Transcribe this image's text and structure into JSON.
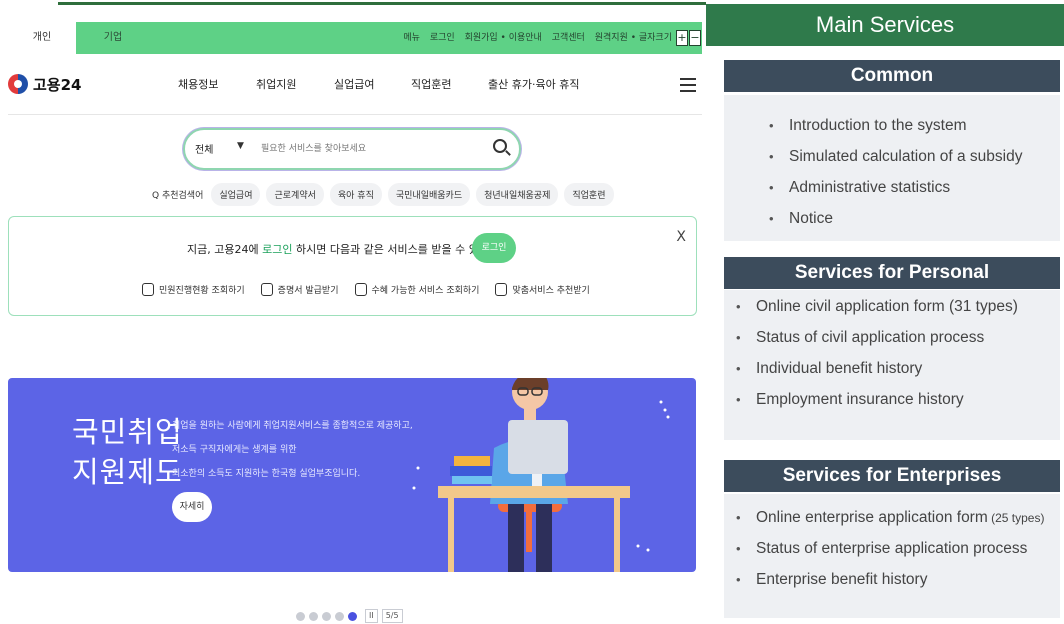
{
  "site": {
    "tabs": [
      {
        "label": "개인"
      },
      {
        "label": "기업"
      }
    ],
    "util_links": [
      "메뉴",
      "로그인",
      "회원가입 • 이용안내",
      "고객센터",
      "원격지원 • 글자크기"
    ],
    "font_plus": "+",
    "font_minus": "−",
    "logo_text": "고용24",
    "nav": [
      "채용정보",
      "취업지원",
      "실업급여",
      "직업훈련",
      "출산 휴가·육아 휴직"
    ],
    "search": {
      "scope": "전체",
      "placeholder": "필요한 서비스를 찾아보세요"
    },
    "recommend_label": "추천검색어",
    "chips": [
      "실업급여",
      "근로계약서",
      "육아 휴직",
      "국민내일배움카드",
      "청년내일채움공제",
      "직업훈련"
    ],
    "notice": {
      "message_before": "지금, 고용24에 ",
      "message_link": "로그인",
      "message_after": " 하시면 다음과 같은 서비스를 받을 수 있습니다.",
      "login_button": "로그인",
      "close": "X",
      "quick_links": [
        "민원진행현황 조회하기",
        "증명서 발급받기",
        "수혜 가능한 서비스 조회하기",
        "맞춤서비스 추천받기"
      ]
    },
    "banner": {
      "title": "국민취업\n지원제도",
      "description": "취업을 원하는 사람에게 취업지원서비스를 종합적으로 제공하고,\n저소득 구직자에게는 생계를 위한\n최소한의 소득도 지원하는 한국형 실업부조입니다.",
      "button": "자세히",
      "color": "#5c64e6"
    },
    "pager": {
      "pause": "II",
      "page": "5/5"
    }
  },
  "panel": {
    "header": "Main Services",
    "sections": [
      {
        "title": "Common",
        "items": [
          "Introduction to the system",
          "Simulated calculation of a subsidy",
          "Administrative statistics",
          "Notice"
        ]
      },
      {
        "title": "Services for Personal",
        "items": [
          "Online civil application form (31 types)",
          "Status of civil application process",
          "Individual benefit history",
          "Employment insurance history"
        ]
      },
      {
        "title": "Services for Enterprises",
        "items_main": "Online enterprise application form",
        "items_main_suffix": " (25 types)",
        "items": [
          "Status of enterprise application process",
          "Enterprise benefit history"
        ]
      }
    ],
    "colors": {
      "header_bg": "#2f7a4b",
      "section_title_bg": "#3c4c5c",
      "section_body_bg": "#eef0f3"
    }
  }
}
